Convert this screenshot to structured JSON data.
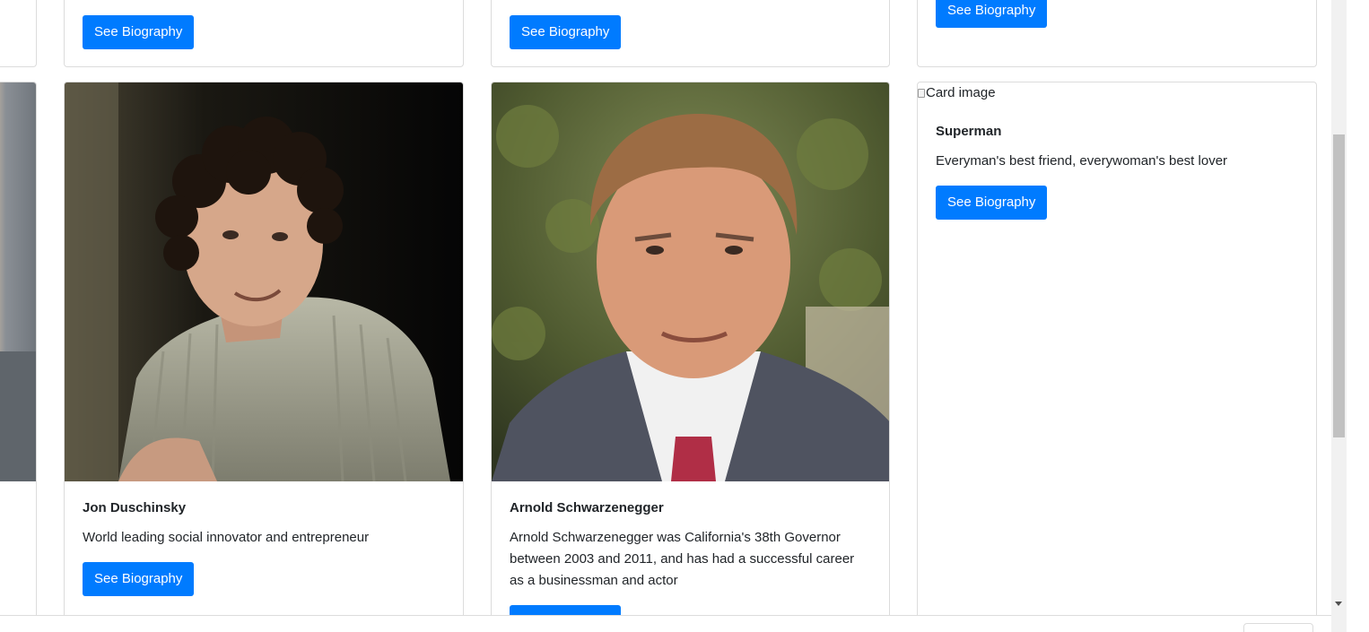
{
  "top_row": {
    "buttons": [
      "See Biography",
      "See Biography",
      "See Biography"
    ]
  },
  "cards": [
    {
      "title": "Jon Duschinsky",
      "text": "World leading social innovator and entrepreneur",
      "button": "See Biography",
      "image": "portrait-photo"
    },
    {
      "title": "Arnold Schwarzenegger",
      "text": "Arnold Schwarzenegger was California's 38th Governor between 2003 and 2011, and has had a successful career as a businessman and actor",
      "button": "See Biography",
      "image": "portrait-photo"
    },
    {
      "title": "Superman",
      "text": "Everyman's best friend, everywoman's best lover",
      "button": "See Biography",
      "image_alt": "Card image"
    }
  ],
  "colors": {
    "primary_button": "#007bff",
    "card_border": "#dcdcdc",
    "scrollbar_thumb": "#c1c1c1"
  }
}
